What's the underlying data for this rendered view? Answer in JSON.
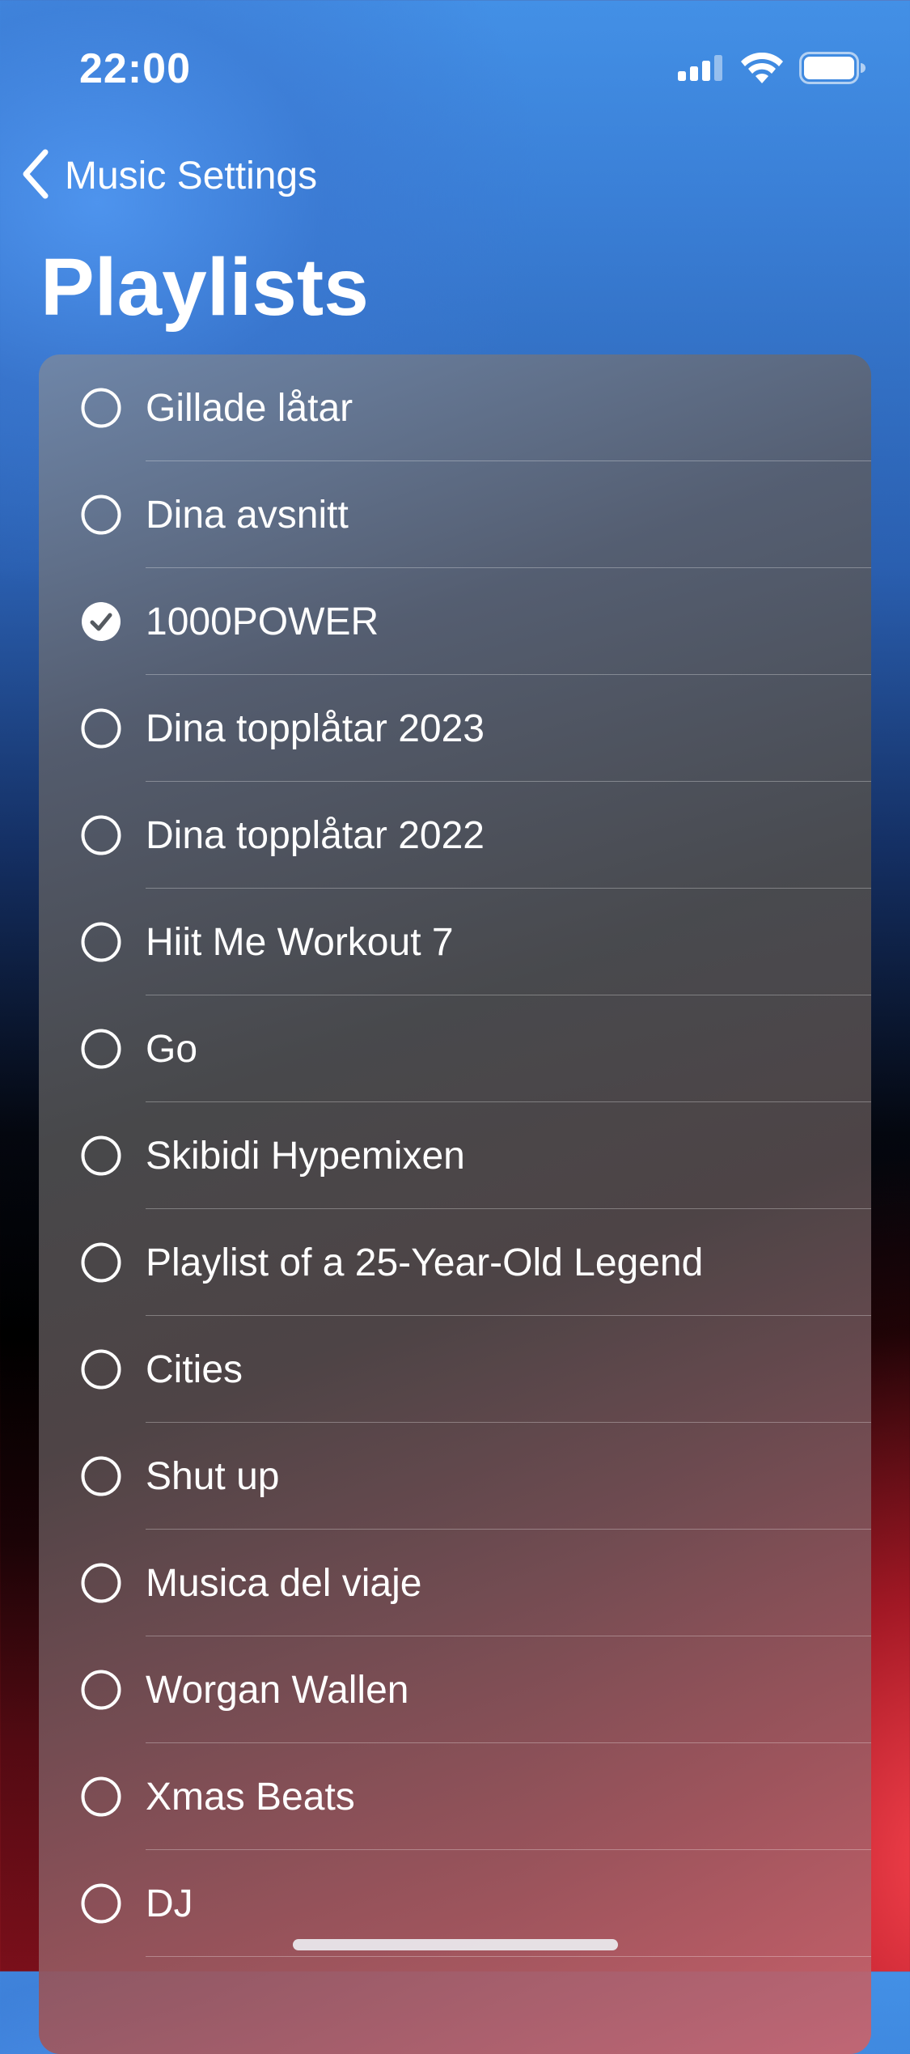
{
  "status_bar": {
    "time": "22:00",
    "icons": [
      "cellular-signal-icon",
      "wifi-icon",
      "battery-icon"
    ]
  },
  "nav": {
    "back_label": "Music Settings",
    "back_icon": "chevron-left-icon"
  },
  "title": "Playlists",
  "playlists": [
    {
      "label": "Gillade låtar",
      "selected": false
    },
    {
      "label": "Dina avsnitt",
      "selected": false
    },
    {
      "label": "1000POWER",
      "selected": true
    },
    {
      "label": "Dina topplåtar 2023",
      "selected": false
    },
    {
      "label": "Dina topplåtar 2022",
      "selected": false
    },
    {
      "label": "Hiit Me Workout 7",
      "selected": false
    },
    {
      "label": "Go",
      "selected": false
    },
    {
      "label": "Skibidi Hypemixen",
      "selected": false
    },
    {
      "label": "Playlist of a 25-Year-Old Legend",
      "selected": false
    },
    {
      "label": "Cities",
      "selected": false
    },
    {
      "label": "Shut up",
      "selected": false
    },
    {
      "label": "Musica del viaje",
      "selected": false
    },
    {
      "label": "Worgan Wallen",
      "selected": false
    },
    {
      "label": "Xmas Beats",
      "selected": false
    },
    {
      "label": "DJ",
      "selected": false
    }
  ],
  "colors": {
    "accent_top": "#4390e6",
    "accent_bottom": "#ff4650",
    "text": "#ffffff"
  }
}
